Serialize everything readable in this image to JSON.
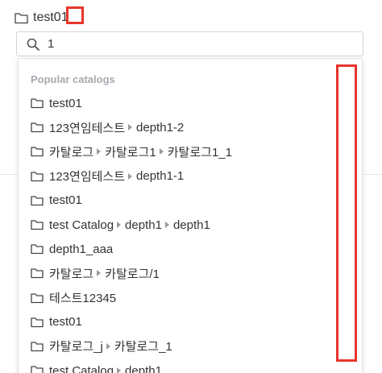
{
  "header": {
    "title": "test01"
  },
  "search": {
    "value": "1",
    "placeholder": ""
  },
  "dropdown": {
    "section_title": "Popular catalogs",
    "items": [
      [
        "test01"
      ],
      [
        "123연임테스트",
        "depth1-2"
      ],
      [
        "카탈로그",
        "카탈로그1",
        "카탈로그1_1"
      ],
      [
        "123연임테스트",
        "depth1-1"
      ],
      [
        "test01"
      ],
      [
        "test Catalog",
        "depth1",
        "depth1"
      ],
      [
        "depth1_aaa"
      ],
      [
        "카탈로그",
        "카탈로그/1"
      ],
      [
        "테스트12345"
      ],
      [
        "test01"
      ],
      [
        "카탈로그_j",
        "카탈로그_1"
      ],
      [
        "test Catalog",
        "depth1"
      ]
    ]
  },
  "icons": {
    "folder": "folder-icon",
    "search": "search-icon",
    "separator": "caret-right-icon"
  },
  "colors": {
    "highlight_box": "#e8352c",
    "section_title": "#a6aab0",
    "text": "#333333"
  }
}
